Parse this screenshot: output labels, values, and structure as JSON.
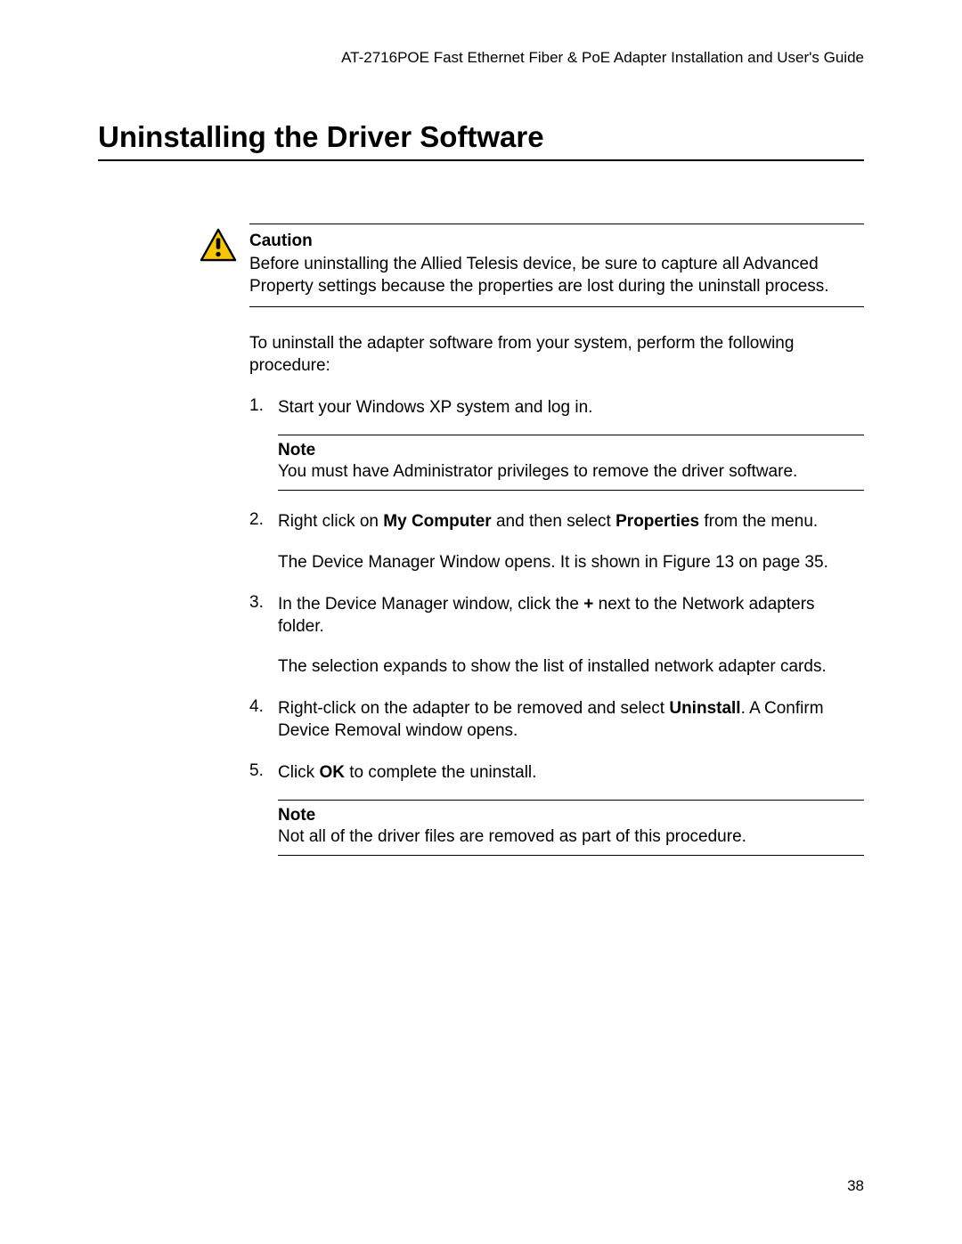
{
  "header": "AT-2716POE Fast Ethernet Fiber & PoE Adapter Installation and User's Guide",
  "title": "Uninstalling the Driver Software",
  "caution": {
    "label": "Caution",
    "body": "Before uninstalling the Allied Telesis device, be sure to capture all Advanced Property settings because the properties are lost during the uninstall process."
  },
  "intro": "To uninstall the adapter software from your system, perform the following procedure:",
  "steps": [
    {
      "body_pre": "Start your Windows XP system and log in.",
      "note": {
        "label": "Note",
        "body": "You must have Administrator privileges to remove the driver software."
      }
    },
    {
      "body_pre": "Right click on ",
      "bold1": "My Computer",
      "body_mid": " and then select ",
      "bold2": "Properties",
      "body_post": " from the menu.",
      "extra": "The Device Manager Window opens. It is shown in Figure 13 on page 35."
    },
    {
      "body_pre": "In the Device Manager window, click the ",
      "bold1": "+",
      "body_post": " next to the Network adapters folder.",
      "extra": "The selection expands to show the list of installed network adapter cards."
    },
    {
      "body_pre": "Right-click on the adapter to be removed and select ",
      "bold1": "Uninstall",
      "body_post": ". A Confirm Device Removal window opens."
    },
    {
      "body_pre": "Click ",
      "bold1": "OK",
      "body_post": " to complete the uninstall.",
      "note": {
        "label": "Note",
        "body": "Not all of the driver files are removed as part of this procedure."
      }
    }
  ],
  "page_number": "38"
}
